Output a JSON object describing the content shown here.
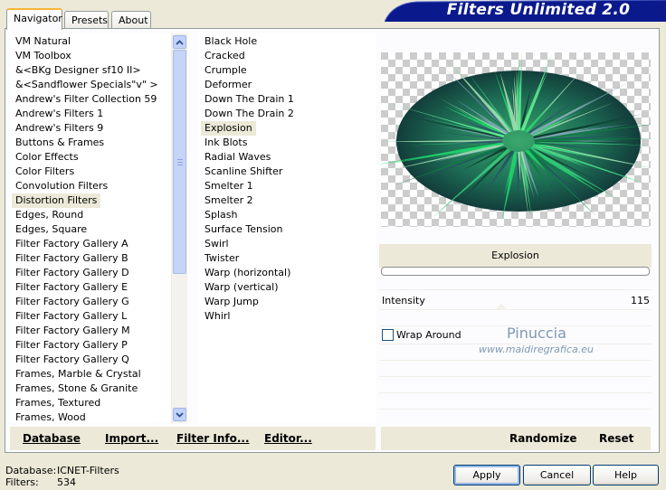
{
  "tabs": [
    {
      "label": "Navigator",
      "active": true
    },
    {
      "label": "Presets",
      "active": false
    },
    {
      "label": "About",
      "active": false
    }
  ],
  "banner": {
    "title": "Filters Unlimited 2.0",
    "color": "#0a1a8c"
  },
  "categories": {
    "items": [
      "VM Natural",
      "VM Toolbox",
      "&<BKg Designer sf10 II>",
      "&<Sandflower Specials\"v\" >",
      "Andrew's Filter Collection 59",
      "Andrew's Filters 1",
      "Andrew's Filters 9",
      "Buttons & Frames",
      "Color Effects",
      "Color Filters",
      "Convolution Filters",
      "Distortion Filters",
      "Edges, Round",
      "Edges, Square",
      "Filter Factory Gallery A",
      "Filter Factory Gallery B",
      "Filter Factory Gallery D",
      "Filter Factory Gallery E",
      "Filter Factory Gallery G",
      "Filter Factory Gallery L",
      "Filter Factory Gallery M",
      "Filter Factory Gallery P",
      "Filter Factory Gallery Q",
      "Frames, Marble & Crystal",
      "Frames, Stone & Granite",
      "Frames, Textured",
      "Frames, Wood"
    ],
    "selected": "Distortion Filters"
  },
  "filters": {
    "items": [
      "Black Hole",
      "Cracked",
      "Crumple",
      "Deformer",
      "Down The Drain 1",
      "Down The Drain 2",
      "Explosion",
      "Ink Blots",
      "Radial Waves",
      "Scanline Shifter",
      "Smelter 1",
      "Smelter 2",
      "Splash",
      "Surface Tension",
      "Swirl",
      "Twister",
      "Warp (horizontal)",
      "Warp (vertical)",
      "Warp Jump",
      "Whirl"
    ],
    "selected": "Explosion"
  },
  "toolbar": {
    "database": "Database",
    "import": "Import...",
    "filter_info": "Filter Info...",
    "editor": "Editor...",
    "randomize": "Randomize",
    "reset": "Reset"
  },
  "preview": {
    "filter_name": "Explosion",
    "progress": 0.0
  },
  "params": {
    "intensity_label": "Intensity",
    "intensity_value": "115",
    "wrap_label": "Wrap Around",
    "wrap_checked": false
  },
  "watermark": {
    "name": "Pinuccia",
    "site": "www.maidiregrafica.eu"
  },
  "footer": {
    "database_label": "Database:",
    "database_value": "ICNET-Filters",
    "filters_label": "Filters:",
    "filters_value": "534",
    "apply": "Apply",
    "cancel": "Cancel",
    "help": "Help"
  }
}
